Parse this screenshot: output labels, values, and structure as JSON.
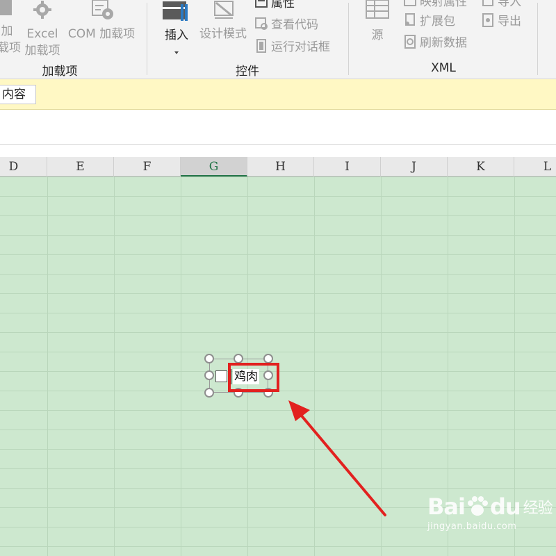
{
  "ribbon": {
    "addins_group": {
      "label": "加载项",
      "partial_button": {
        "line1": "加",
        "line2": "载项"
      },
      "excel_addins": {
        "line1": "Excel",
        "line2": "加载项"
      },
      "com_addins": "COM 加载项"
    },
    "controls_group": {
      "label": "控件",
      "insert": "插入",
      "design_mode": "设计模式",
      "properties": "属性",
      "view_code": "查看代码",
      "run_dialog": "运行对话框"
    },
    "xml_group": {
      "label": "XML",
      "source": "源",
      "map_properties": "映射属性",
      "expansion_pack": "扩展包",
      "refresh_data": "刷新数据",
      "import": "导入",
      "export": "导出"
    }
  },
  "message_bar": {
    "button_label": "内容"
  },
  "columns": [
    "D",
    "E",
    "F",
    "G",
    "H",
    "I",
    "J",
    "K",
    "L"
  ],
  "selected_column": "G",
  "checkbox_control": {
    "label": "鸡肉",
    "checked": false
  },
  "watermark": {
    "logo_text": "Bai",
    "logo_text2": "du",
    "logo_cn": "经验",
    "url": "jingyan.baidu.com"
  },
  "colors": {
    "grid_bg": "#cde8cf",
    "highlight_red": "#e2211f",
    "message_bar_bg": "#fff8c4",
    "selected_header_text": "#217346"
  }
}
